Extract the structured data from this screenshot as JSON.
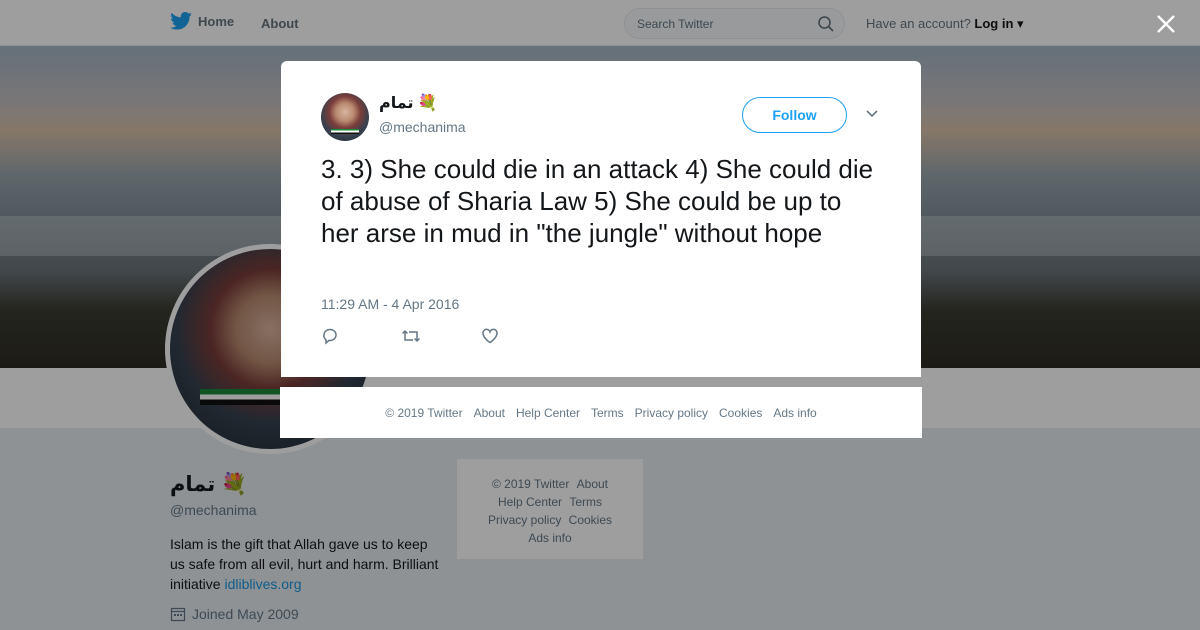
{
  "nav": {
    "home": "Home",
    "about": "About",
    "search_placeholder": "Search Twitter",
    "have_account": "Have an account?",
    "login": "Log in"
  },
  "profile": {
    "display_name": "تمام",
    "handle": "@mechanima",
    "bio_text": "Islam is the gift that Allah gave us to keep us safe from all evil, hurt and harm. Brilliant initiative ",
    "bio_link": "idliblives.org",
    "joined": "Joined May 2009"
  },
  "side_footer": {
    "copyright": "© 2019 Twitter",
    "about": "About",
    "help": "Help Center",
    "terms": "Terms",
    "privacy": "Privacy policy",
    "cookies": "Cookies",
    "ads": "Ads info"
  },
  "tweet": {
    "display_name": "تمام",
    "handle": "@mechanima",
    "follow_label": "Follow",
    "text": "3. 3) She could die in an attack 4) She could die of abuse of Sharia Law 5) She could be up to her arse in mud in \"the jungle\" without hope",
    "timestamp": "11:29 AM - 4 Apr 2016"
  },
  "modal_footer": {
    "copyright": "© 2019 Twitter",
    "about": "About",
    "help": "Help Center",
    "terms": "Terms",
    "privacy": "Privacy policy",
    "cookies": "Cookies",
    "ads": "Ads info"
  },
  "icons": {
    "bird": "twitter-bird-icon",
    "search": "search-icon",
    "close": "close-icon",
    "flower": "bouquet-emoji-icon",
    "reply": "reply-icon",
    "retweet": "retweet-icon",
    "like": "heart-icon",
    "calendar": "calendar-icon",
    "caret": "chevron-down-icon"
  },
  "colors": {
    "brand": "#1da1f2",
    "link": "#1b95e0",
    "muted": "#657786"
  }
}
